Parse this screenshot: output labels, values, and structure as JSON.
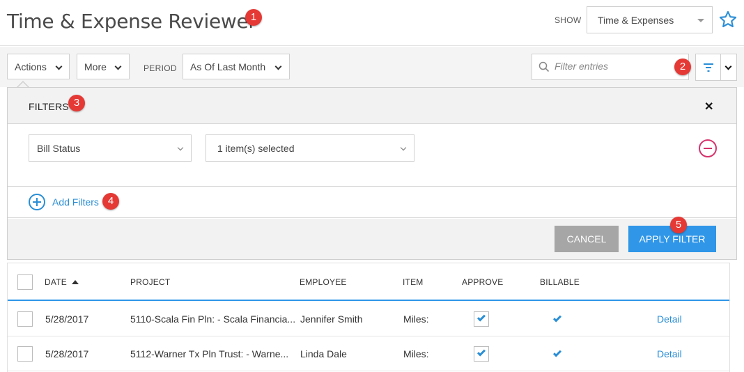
{
  "header": {
    "title": "Time & Expense Reviewer",
    "show_label": "SHOW",
    "show_value": "Time & Expenses",
    "star_icon": "star-outline-icon"
  },
  "annotations": [
    "1",
    "2",
    "3",
    "4",
    "5"
  ],
  "toolbar": {
    "actions_label": "Actions",
    "more_label": "More",
    "period_label": "PERIOD",
    "period_value": "As Of Last Month",
    "search_placeholder": "Filter entries",
    "search_icon": "magnifier-icon",
    "filter_icon": "filter-lines-icon"
  },
  "filters_panel": {
    "title": "FILTERS",
    "close_icon": "close-x-icon",
    "rows": [
      {
        "field": "Bill Status",
        "value": "1 item(s) selected"
      }
    ],
    "add_label": "Add Filters",
    "cancel_label": "CANCEL",
    "apply_label": "APPLY FILTER"
  },
  "table": {
    "columns": [
      "DATE",
      "PROJECT",
      "EMPLOYEE",
      "ITEM",
      "APPROVE",
      "BILLABLE"
    ],
    "rows": [
      {
        "date": "5/28/2017",
        "project": "5110-Scala Fin Pln: - Scala Financia...",
        "employee": "Jennifer Smith",
        "item": "Miles:",
        "approve": true,
        "billable": true,
        "detail": "Detail"
      },
      {
        "date": "5/28/2017",
        "project": "5112-Warner Tx Pln Trust: - Warne...",
        "employee": "Linda Dale",
        "item": "Miles:",
        "approve": true,
        "billable": true,
        "detail": "Detail"
      }
    ]
  },
  "colors": {
    "accent": "#2f96e8",
    "badge": "#e53935",
    "remove": "#d6336c",
    "cancel": "#a6a6a6"
  }
}
